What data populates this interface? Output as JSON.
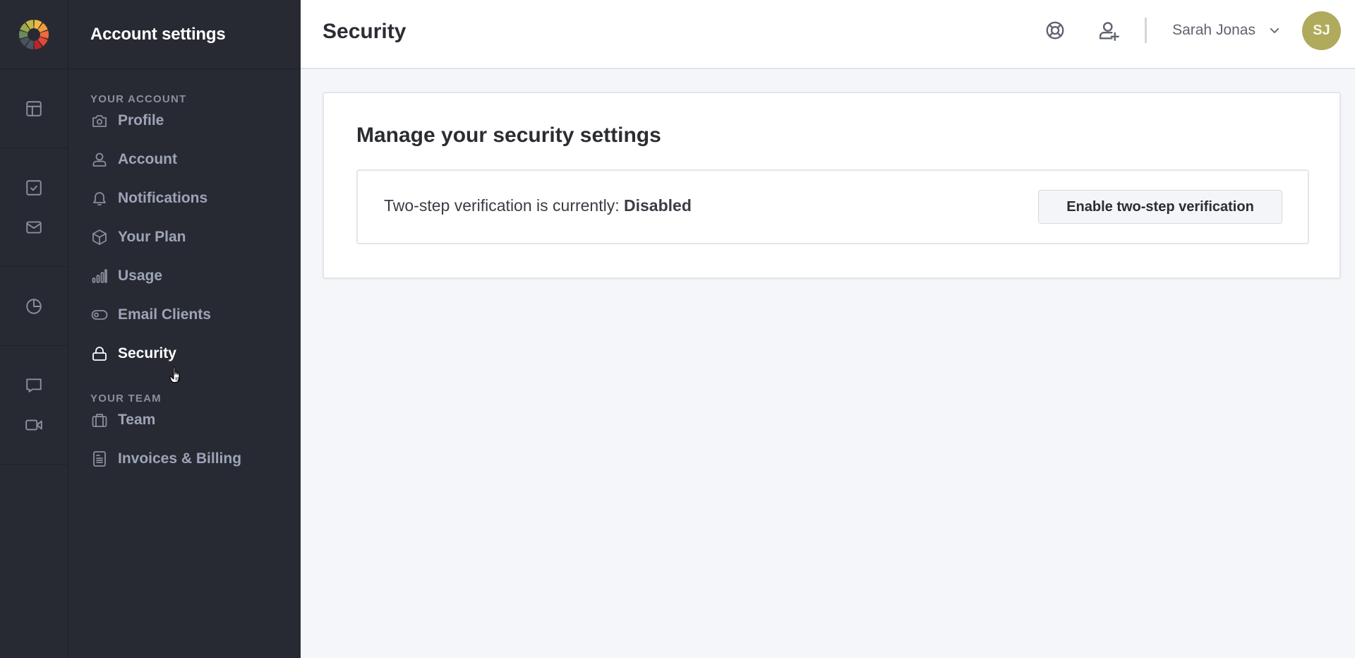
{
  "rail": {
    "logo": "color-wheel-logo",
    "groups": [
      [
        "layout-icon"
      ],
      [
        "task-check-icon",
        "mail-icon"
      ],
      [
        "clock-pie-icon"
      ],
      [
        "chat-bubble-icon",
        "video-camera-icon"
      ]
    ]
  },
  "sidebar": {
    "title": "Account settings",
    "sections": [
      {
        "label": "YOUR ACCOUNT",
        "items": [
          {
            "label": "Profile",
            "icon": "camera-icon"
          },
          {
            "label": "Account",
            "icon": "user-icon"
          },
          {
            "label": "Notifications",
            "icon": "bell-icon"
          },
          {
            "label": "Your Plan",
            "icon": "box-icon"
          },
          {
            "label": "Usage",
            "icon": "bar-chart-icon"
          },
          {
            "label": "Email Clients",
            "icon": "toggle-icon"
          },
          {
            "label": "Security",
            "icon": "lock-icon",
            "active": true
          }
        ]
      },
      {
        "label": "YOUR TEAM",
        "items": [
          {
            "label": "Team",
            "icon": "briefcase-icon"
          },
          {
            "label": "Invoices & Billing",
            "icon": "document-icon"
          }
        ]
      }
    ]
  },
  "header": {
    "title": "Security",
    "help_icon": "lifebuoy-icon",
    "invite_icon": "add-user-icon",
    "user_name": "Sarah Jonas",
    "avatar_initials": "SJ",
    "avatar_color": "#b0aa5c"
  },
  "main": {
    "card_title": "Manage your security settings",
    "status_prefix": "Two-step verification is currently: ",
    "status_value": "Disabled",
    "enable_button": "Enable two-step verification"
  }
}
